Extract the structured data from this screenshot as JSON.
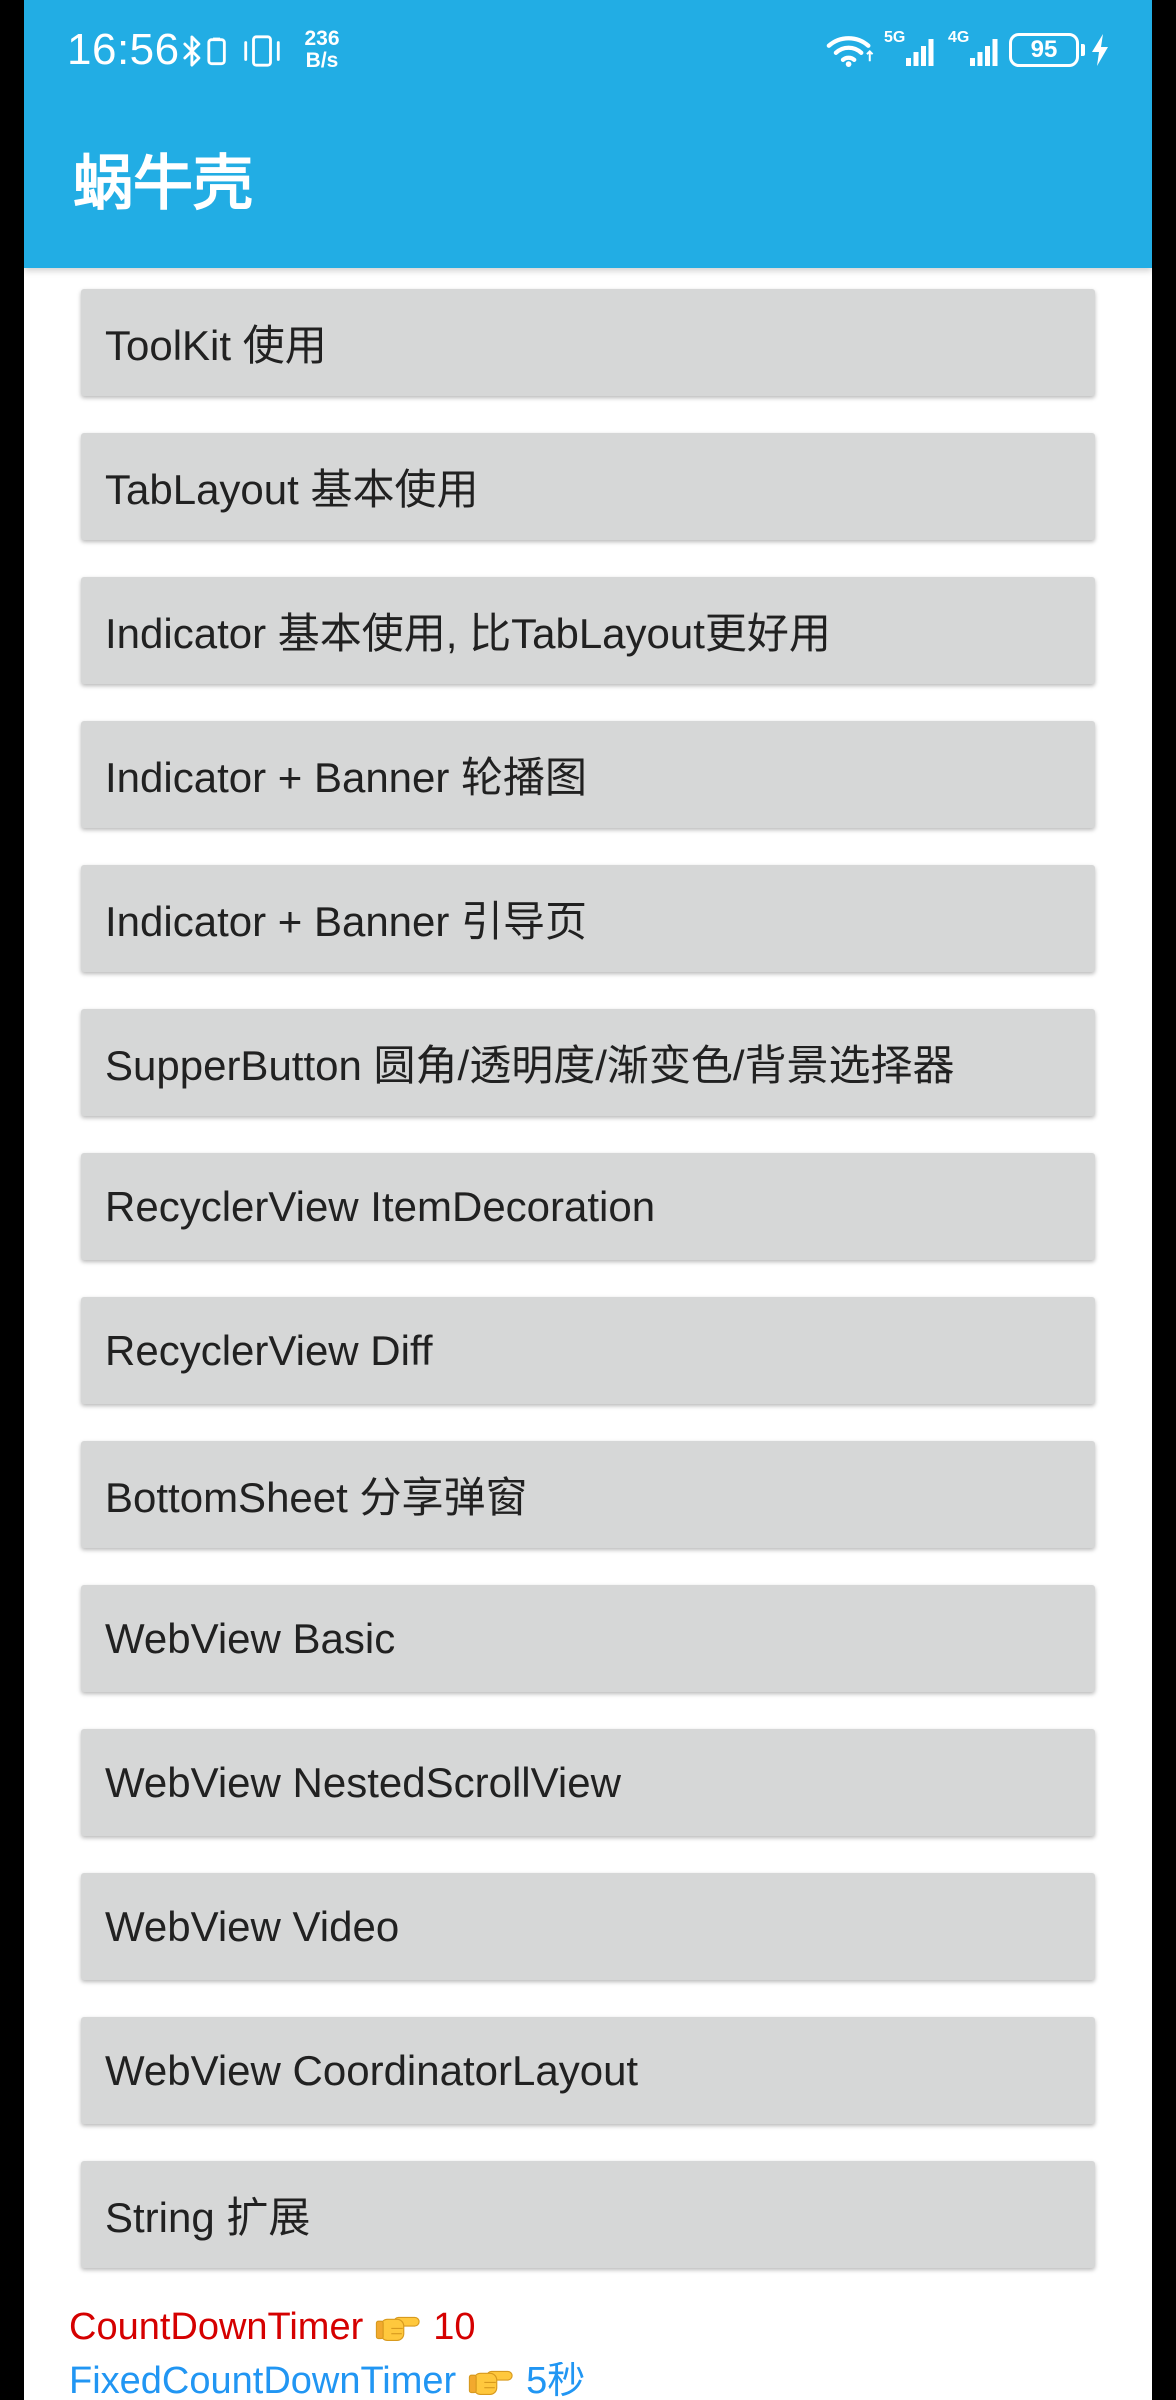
{
  "status_bar": {
    "time": "16:56",
    "net_speed_value": "236",
    "net_speed_unit": "B/s",
    "signal_1_label": "5G",
    "signal_2_label": "4G",
    "battery_level": "95",
    "icons": [
      "bluetooth-icon",
      "bluetooth-device-battery-icon",
      "vibrate-icon",
      "wifi-icon",
      "signal-bars-icon",
      "battery-icon",
      "charging-bolt-icon"
    ]
  },
  "toolbar": {
    "title": "蜗牛壳"
  },
  "colors": {
    "primary": "#22ADE4",
    "button_bg": "#D6D7D7",
    "countdown_red": "#D50000",
    "countdown_blue": "#2196F3"
  },
  "menu_items": [
    "ToolKit 使用",
    "TabLayout 基本使用",
    "Indicator 基本使用, 比TabLayout更好用",
    "Indicator + Banner 轮播图",
    "Indicator + Banner 引导页",
    "SupperButton 圆角/透明度/渐变色/背景选择器",
    "RecyclerView ItemDecoration",
    "RecyclerView Diff",
    "BottomSheet 分享弹窗",
    "WebView Basic",
    "WebView NestedScrollView",
    "WebView Video",
    "WebView CoordinatorLayout",
    "String 扩展"
  ],
  "countdowns": [
    {
      "label": "CountDownTimer",
      "icon": "pointing-right-hand-icon",
      "value": "10"
    },
    {
      "label": "FixedCountDownTimer",
      "icon": "pointing-right-hand-icon",
      "value": "5秒"
    }
  ]
}
